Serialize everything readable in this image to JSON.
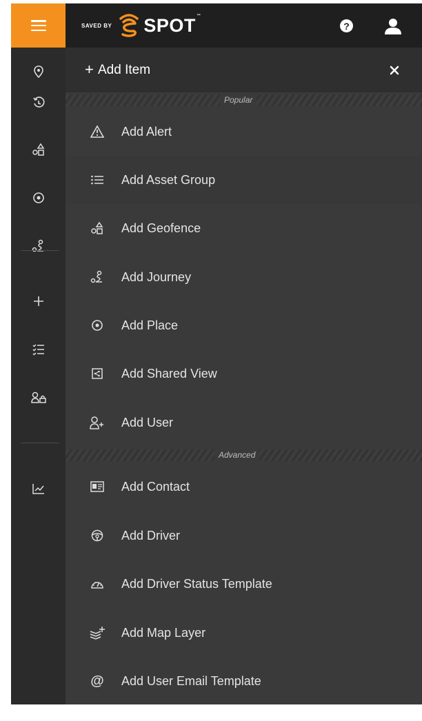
{
  "brand": {
    "saved_by": "SAVED BY",
    "name": "SPOT",
    "tm": "™"
  },
  "topbar": {
    "help_icon": "help-icon",
    "user_icon": "user-icon",
    "accent": "#f4911e"
  },
  "sidebar": {
    "items": [
      {
        "name": "location-pin-icon"
      },
      {
        "name": "history-icon"
      },
      {
        "name": "geofence-icon"
      },
      {
        "name": "place-icon"
      },
      {
        "name": "journey-icon"
      },
      {
        "name": "add-icon"
      },
      {
        "name": "checklist-icon"
      },
      {
        "name": "users-icon"
      },
      {
        "name": "chart-icon"
      }
    ]
  },
  "panel": {
    "title": "Add Item",
    "sections": {
      "popular": "Popular",
      "advanced": "Advanced"
    },
    "popular_items": [
      {
        "label": "Add Alert",
        "icon": "alert-icon"
      },
      {
        "label": "Add Asset Group",
        "icon": "list-icon"
      },
      {
        "label": "Add Geofence",
        "icon": "geofence-icon"
      },
      {
        "label": "Add Journey",
        "icon": "journey-icon"
      },
      {
        "label": "Add Place",
        "icon": "place-icon"
      },
      {
        "label": "Add Shared View",
        "icon": "shared-view-icon"
      },
      {
        "label": "Add User",
        "icon": "add-user-icon"
      }
    ],
    "advanced_items": [
      {
        "label": "Add Contact",
        "icon": "contact-card-icon"
      },
      {
        "label": "Add Driver",
        "icon": "steering-wheel-icon"
      },
      {
        "label": "Add Driver Status Template",
        "icon": "gauge-icon"
      },
      {
        "label": "Add Map Layer",
        "icon": "map-layer-icon"
      },
      {
        "label": "Add User Email Template",
        "icon": "at-icon"
      }
    ]
  }
}
